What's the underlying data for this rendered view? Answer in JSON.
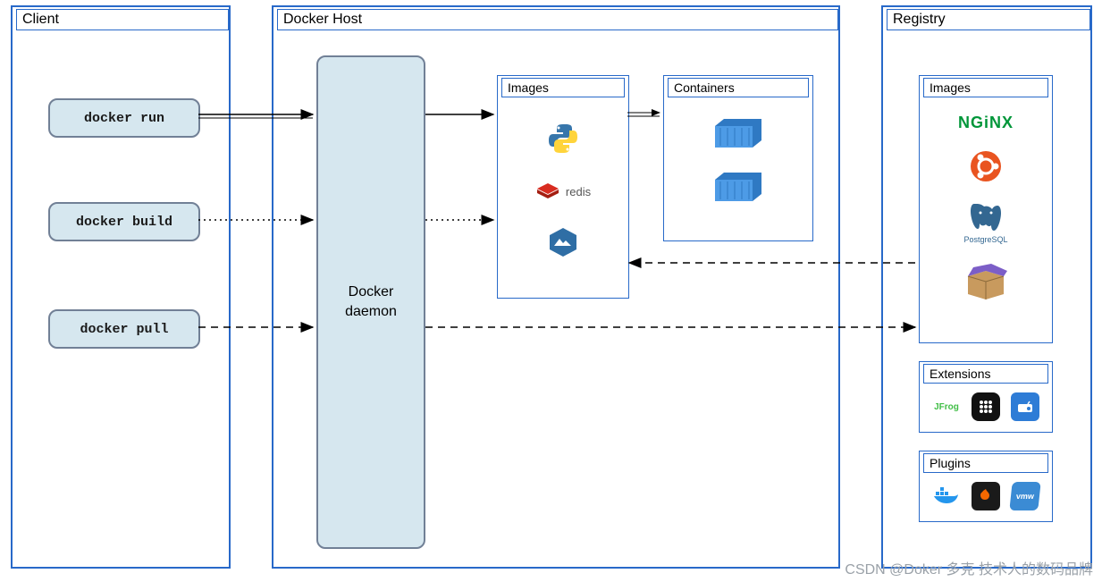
{
  "client": {
    "title": "Client",
    "cmds": [
      "docker run",
      "docker build",
      "docker pull"
    ]
  },
  "host": {
    "title": "Docker Host",
    "daemon": "Docker\ndaemon",
    "images_title": "Images",
    "containers_title": "Containers",
    "images": [
      "python",
      "redis",
      "mini"
    ],
    "containers": 2
  },
  "registry": {
    "title": "Registry",
    "images_title": "Images",
    "images": [
      "NGINX",
      "ubuntu",
      "PostgreSQL",
      "box"
    ],
    "extensions_title": "Extensions",
    "extensions": [
      "JFrog",
      "grid",
      "radio"
    ],
    "plugins_title": "Plugins",
    "plugins": [
      "docker",
      "grafana",
      "vmw"
    ]
  },
  "watermark": "CSDN @Doker 多克 技术人的数码品牌"
}
